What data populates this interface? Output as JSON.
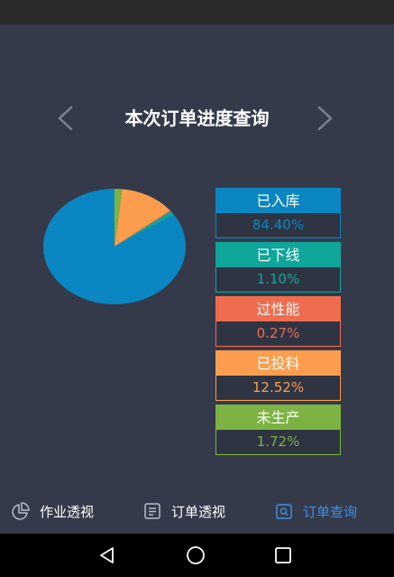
{
  "header": {
    "title": "本次订单进度查询"
  },
  "colors": {
    "ruku": "#0a87c2",
    "xiaxian": "#10a69a",
    "guoxingneng": "#ef6c4f",
    "touliao": "#fb9d4d",
    "weishengchan": "#7cb342",
    "tab_active": "#3e8fe0"
  },
  "chart_data": {
    "type": "pie",
    "slices": [
      {
        "name": "已入库",
        "value": 84.4,
        "color": "#0a87c2"
      },
      {
        "name": "已下线",
        "value": 1.1,
        "color": "#10a69a"
      },
      {
        "name": "过性能",
        "value": 0.27,
        "color": "#ef6c4f"
      },
      {
        "name": "已投料",
        "value": 12.52,
        "color": "#fb9d4d"
      },
      {
        "name": "未生产",
        "value": 1.72,
        "color": "#7cb342"
      }
    ]
  },
  "legend": [
    {
      "label": "已入库",
      "value": "84.40%"
    },
    {
      "label": "已下线",
      "value": "1.10%"
    },
    {
      "label": "过性能",
      "value": "0.27%"
    },
    {
      "label": "已投料",
      "value": "12.52%"
    },
    {
      "label": "未生产",
      "value": "1.72%"
    }
  ],
  "tabs": [
    {
      "label": "作业透视",
      "icon": "pie-chart-icon"
    },
    {
      "label": "订单透视",
      "icon": "document-icon"
    },
    {
      "label": "订单查询",
      "icon": "search-icon",
      "active": true
    }
  ],
  "system_nav": [
    "back-icon",
    "home-icon",
    "recents-icon"
  ]
}
